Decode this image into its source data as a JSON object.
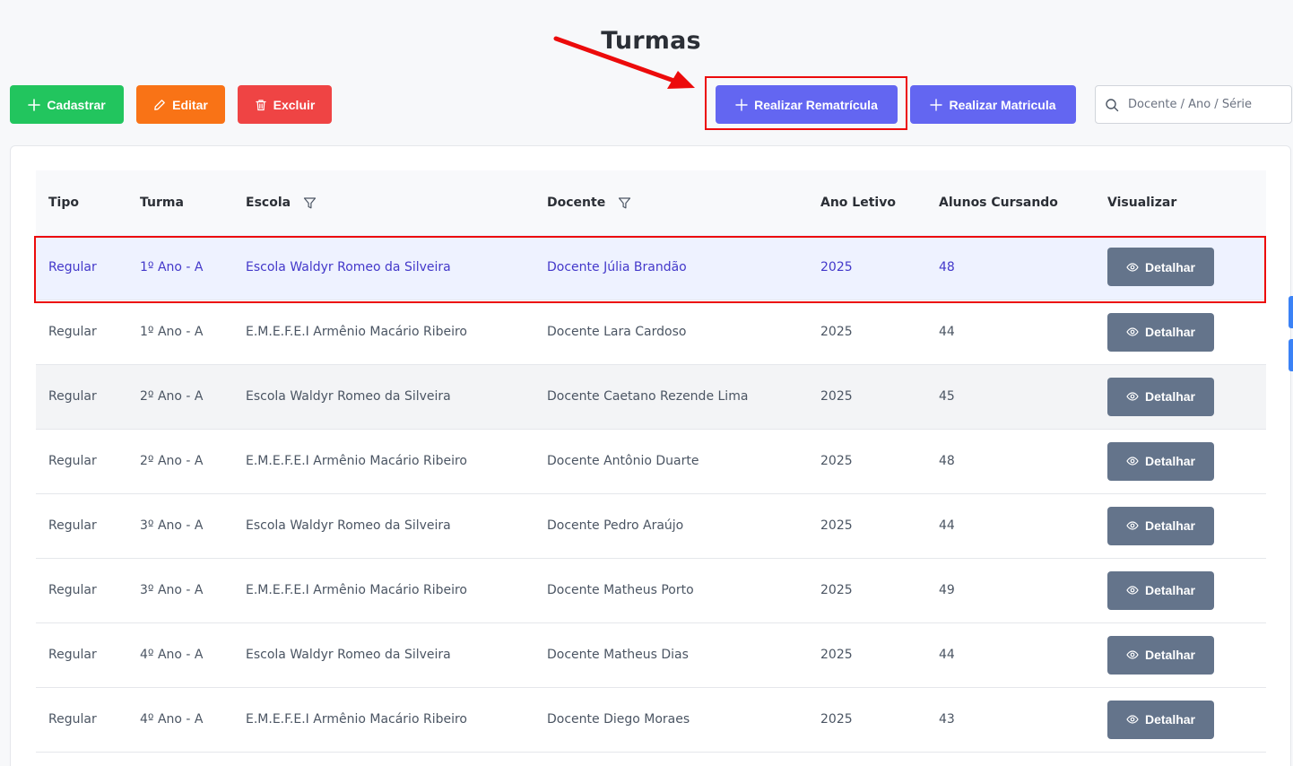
{
  "page": {
    "title": "Turmas"
  },
  "toolbar": {
    "cadastrar": "Cadastrar",
    "editar": "Editar",
    "excluir": "Excluir",
    "rematricula": "Realizar Rematrícula",
    "matricula": "Realizar Matricula",
    "search_placeholder": "Docente / Ano / Série"
  },
  "table": {
    "headers": {
      "tipo": "Tipo",
      "turma": "Turma",
      "escola": "Escola",
      "docente": "Docente",
      "ano": "Ano Letivo",
      "alunos": "Alunos Cursando",
      "visualizar": "Visualizar"
    },
    "detail_label": "Detalhar",
    "rows": [
      {
        "tipo": "Regular",
        "turma": "1º Ano - A",
        "escola": "Escola Waldyr Romeo da Silveira",
        "docente": "Docente Júlia Brandão",
        "ano": "2025",
        "alunos": "48"
      },
      {
        "tipo": "Regular",
        "turma": "1º Ano - A",
        "escola": "E.M.E.F.E.I Armênio Macário Ribeiro",
        "docente": "Docente Lara Cardoso",
        "ano": "2025",
        "alunos": "44"
      },
      {
        "tipo": "Regular",
        "turma": "2º Ano - A",
        "escola": "Escola Waldyr Romeo da Silveira",
        "docente": "Docente Caetano Rezende Lima",
        "ano": "2025",
        "alunos": "45"
      },
      {
        "tipo": "Regular",
        "turma": "2º Ano - A",
        "escola": "E.M.E.F.E.I Armênio Macário Ribeiro",
        "docente": "Docente Antônio Duarte",
        "ano": "2025",
        "alunos": "48"
      },
      {
        "tipo": "Regular",
        "turma": "3º Ano - A",
        "escola": "Escola Waldyr Romeo da Silveira",
        "docente": "Docente Pedro Araújo",
        "ano": "2025",
        "alunos": "44"
      },
      {
        "tipo": "Regular",
        "turma": "3º Ano - A",
        "escola": "E.M.E.F.E.I Armênio Macário Ribeiro",
        "docente": "Docente Matheus Porto",
        "ano": "2025",
        "alunos": "49"
      },
      {
        "tipo": "Regular",
        "turma": "4º Ano - A",
        "escola": "Escola Waldyr Romeo da Silveira",
        "docente": "Docente Matheus Dias",
        "ano": "2025",
        "alunos": "44"
      },
      {
        "tipo": "Regular",
        "turma": "4º Ano - A",
        "escola": "E.M.E.F.E.I Armênio Macário Ribeiro",
        "docente": "Docente Diego Moraes",
        "ano": "2025",
        "alunos": "43"
      }
    ]
  }
}
